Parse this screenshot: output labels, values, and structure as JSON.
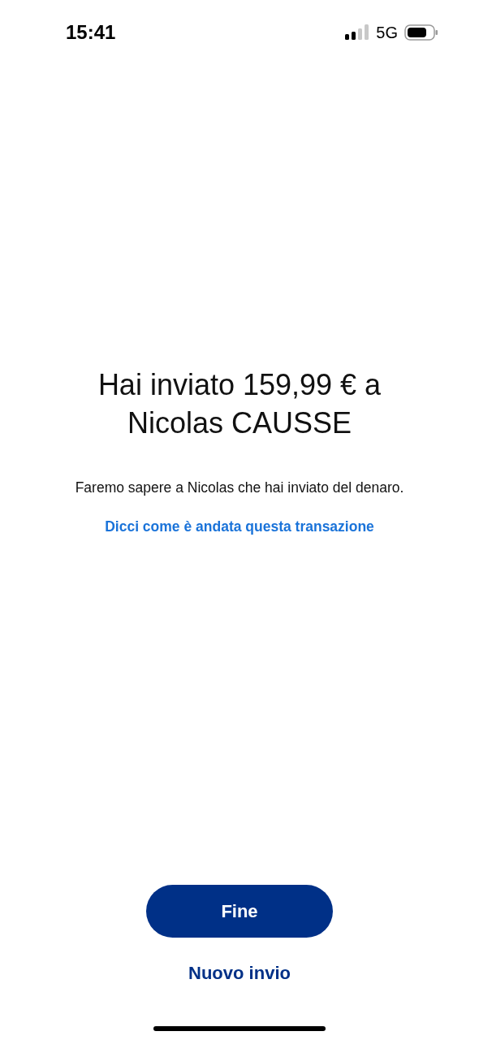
{
  "status_bar": {
    "time": "15:41",
    "network": "5G"
  },
  "title": "Hai inviato 159,99 € a Nicolas CAUSSE",
  "message": "Faremo sapere a Nicolas che hai inviato del denaro.",
  "feedback_link": "Dicci come è andata questa transazione",
  "buttons": [
    {
      "kind": "primary",
      "label": "Fine"
    },
    {
      "kind": "text",
      "label": "Nuovo invio"
    }
  ]
}
